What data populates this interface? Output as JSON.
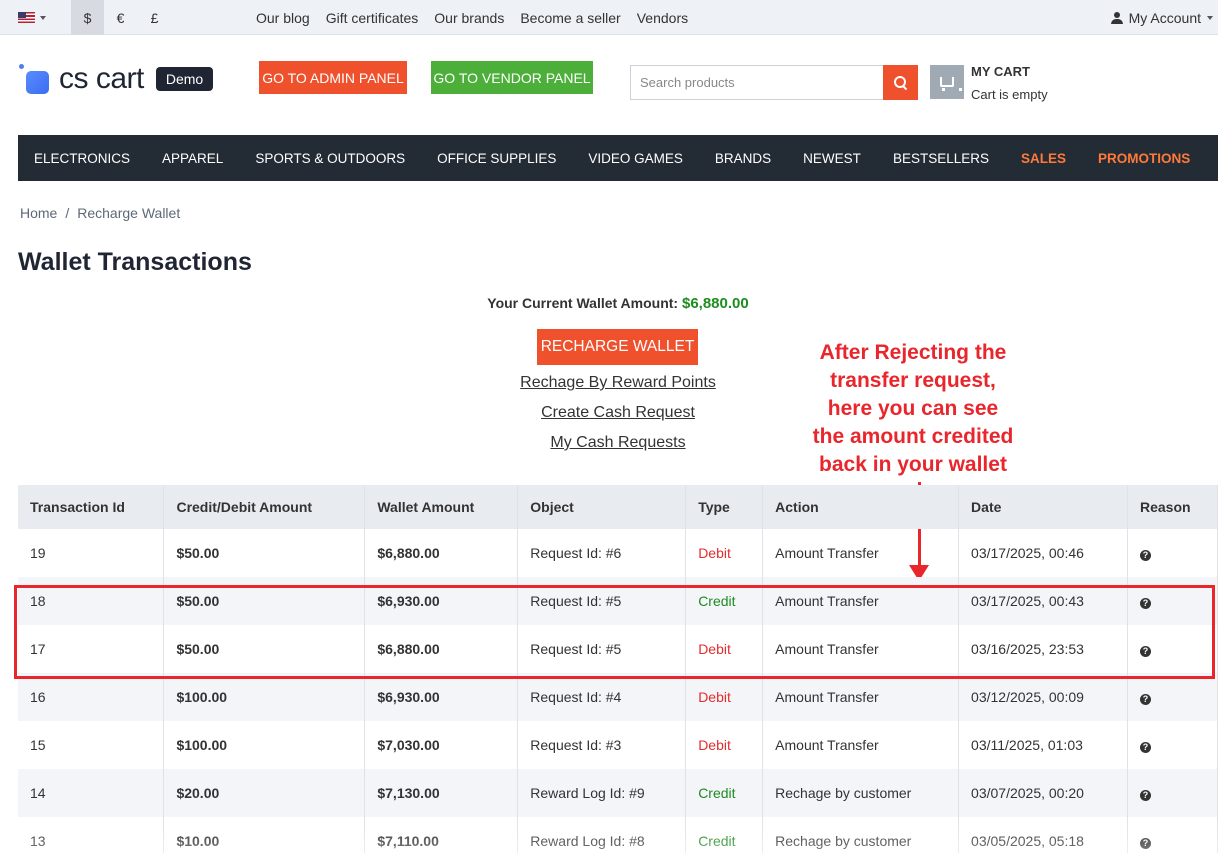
{
  "topbar": {
    "currencies": [
      "$",
      "€",
      "£"
    ],
    "links": [
      "Our blog",
      "Gift certificates",
      "Our brands",
      "Become a seller",
      "Vendors"
    ],
    "account_label": "My Account"
  },
  "header": {
    "logo_text": "cs cart",
    "demo_badge": "Demo",
    "admin_button": "GO TO ADMIN PANEL",
    "vendor_button": "GO TO VENDOR PANEL",
    "search_placeholder": "Search products",
    "cart_title": "MY CART",
    "cart_status": "Cart is empty"
  },
  "nav": {
    "items": [
      "ELECTRONICS",
      "APPAREL",
      "SPORTS & OUTDOORS",
      "OFFICE SUPPLIES",
      "VIDEO GAMES",
      "BRANDS",
      "NEWEST",
      "BESTSELLERS",
      "SALES",
      "PROMOTIONS"
    ],
    "highlight_color": "#ff7a38"
  },
  "breadcrumb": {
    "home": "Home",
    "separator": "/",
    "current": "Recharge Wallet"
  },
  "page_title": "Wallet Transactions",
  "wallet": {
    "amount_label": "Your Current Wallet Amount:",
    "amount_value": "$6,880.00",
    "recharge_button": "RECHARGE WALLET",
    "links": [
      "Rechage By Reward Points",
      "Create Cash Request",
      "My Cash Requests"
    ]
  },
  "annotation": {
    "lines": [
      "After Rejecting the",
      "transfer request,",
      "here you can see",
      "the amount credited",
      "back in your wallet"
    ],
    "color": "#e8262c"
  },
  "table": {
    "headers": [
      "Transaction Id",
      "Credit/Debit Amount",
      "Wallet Amount",
      "Object",
      "Type",
      "Action",
      "Date",
      "Reason"
    ],
    "rows": [
      {
        "id": "19",
        "amount": "$50.00",
        "wallet": "$6,880.00",
        "object": "Request Id: #6",
        "type": "Debit",
        "action": "Amount Transfer",
        "date": "03/17/2025, 00:46"
      },
      {
        "id": "18",
        "amount": "$50.00",
        "wallet": "$6,930.00",
        "object": "Request Id: #5",
        "type": "Credit",
        "action": "Amount Transfer",
        "date": "03/17/2025, 00:43"
      },
      {
        "id": "17",
        "amount": "$50.00",
        "wallet": "$6,880.00",
        "object": "Request Id: #5",
        "type": "Debit",
        "action": "Amount Transfer",
        "date": "03/16/2025, 23:53"
      },
      {
        "id": "16",
        "amount": "$100.00",
        "wallet": "$6,930.00",
        "object": "Request Id: #4",
        "type": "Debit",
        "action": "Amount Transfer",
        "date": "03/12/2025, 00:09"
      },
      {
        "id": "15",
        "amount": "$100.00",
        "wallet": "$7,030.00",
        "object": "Request Id: #3",
        "type": "Debit",
        "action": "Amount Transfer",
        "date": "03/11/2025, 01:03"
      },
      {
        "id": "14",
        "amount": "$20.00",
        "wallet": "$7,130.00",
        "object": "Reward Log Id: #9",
        "type": "Credit",
        "action": "Rechage by customer",
        "date": "03/07/2025, 00:20"
      },
      {
        "id": "13",
        "amount": "$10.00",
        "wallet": "$7,110.00",
        "object": "Reward Log Id: #8",
        "type": "Credit",
        "action": "Rechage by customer",
        "date": "03/05/2025, 05:18"
      }
    ],
    "reason_icon": "help-icon",
    "debit_color": "#e22d2d",
    "credit_color": "#1e8c1e"
  }
}
